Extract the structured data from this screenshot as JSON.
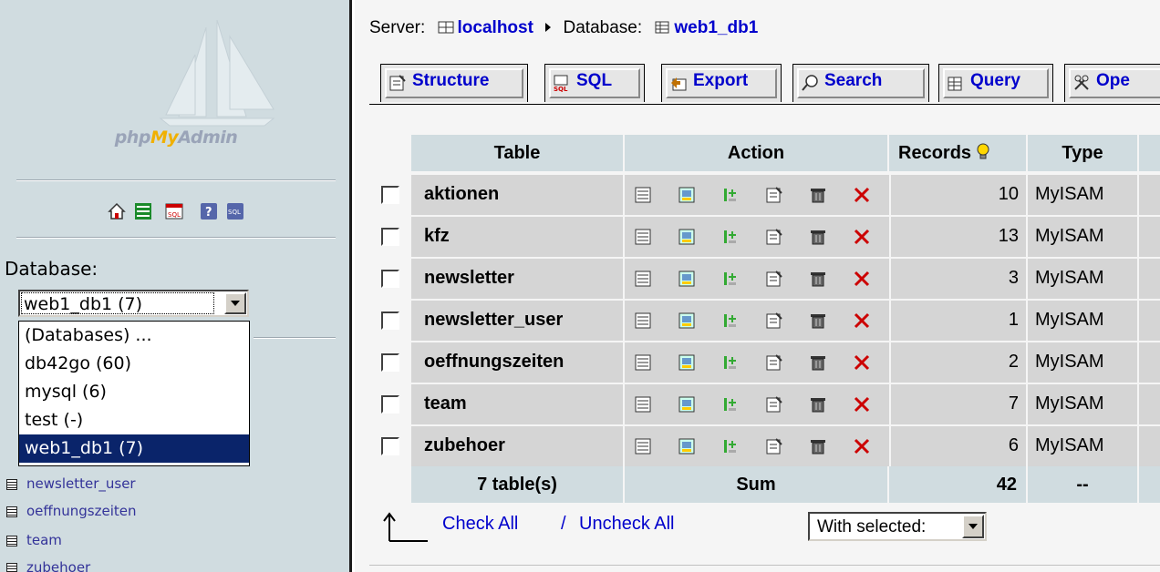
{
  "nav": {
    "logo": {
      "php": "php",
      "my": "My",
      "admin": "Admin"
    },
    "quick_icons": [
      "home-icon",
      "exit-icon",
      "sql-query-icon",
      "docs-icon",
      "sql-docs-icon"
    ],
    "database_label": "Database:",
    "database_select": {
      "value": "web1_db1 (7)"
    },
    "database_options": [
      {
        "label": "(Databases) ...",
        "selected": false
      },
      {
        "label": "db42go (60)",
        "selected": false
      },
      {
        "label": "mysql (6)",
        "selected": false
      },
      {
        "label": "test (-)",
        "selected": false
      },
      {
        "label": "web1_db1 (7)",
        "selected": true
      }
    ],
    "tables": [
      "newsletter_user",
      "oeffnungszeiten",
      "team",
      "zubehoer"
    ]
  },
  "breadcrumb": {
    "server_label": "Server:",
    "server": "localhost",
    "database_label": "Database:",
    "database": "web1_db1"
  },
  "tabs": [
    {
      "label": "Structure",
      "icon": "structure-icon"
    },
    {
      "label": "SQL",
      "icon": "sql-icon"
    },
    {
      "label": "Export",
      "icon": "export-icon"
    },
    {
      "label": "Search",
      "icon": "search-icon"
    },
    {
      "label": "Query",
      "icon": "query-icon"
    },
    {
      "label": "Ope",
      "icon": "operations-icon"
    }
  ],
  "table": {
    "headers": {
      "table": "Table",
      "action": "Action",
      "records": "Records",
      "type": "Type"
    },
    "action_icons": [
      "browse-icon",
      "select-icon",
      "insert-icon",
      "properties-icon",
      "empty-icon",
      "drop-icon"
    ],
    "rows": [
      {
        "name": "aktionen",
        "records": "10",
        "type": "MyISAM"
      },
      {
        "name": "kfz",
        "records": "13",
        "type": "MyISAM"
      },
      {
        "name": "newsletter",
        "records": "3",
        "type": "MyISAM"
      },
      {
        "name": "newsletter_user",
        "records": "1",
        "type": "MyISAM"
      },
      {
        "name": "oeffnungszeiten",
        "records": "2",
        "type": "MyISAM"
      },
      {
        "name": "team",
        "records": "7",
        "type": "MyISAM"
      },
      {
        "name": "zubehoer",
        "records": "6",
        "type": "MyISAM"
      }
    ],
    "footer": {
      "count": "7 table(s)",
      "sum_label": "Sum",
      "sum_records": "42",
      "type": "--"
    }
  },
  "bulk": {
    "check_all": "Check All",
    "separator": "/",
    "uncheck_all": "Uncheck All",
    "with_selected": "With selected:"
  },
  "colors": {
    "nav_bg": "#d0dce0",
    "header_bg": "#d0dce0",
    "row_bg": "#d5d5d5",
    "link": "#0000cc",
    "selected_option": "#0a246a"
  }
}
